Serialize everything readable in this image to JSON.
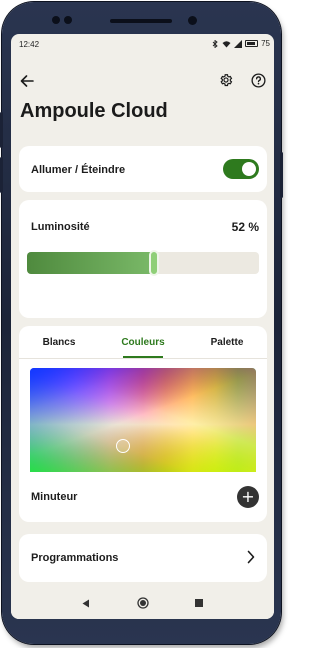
{
  "status_bar": {
    "time": "12:42",
    "battery": "75"
  },
  "app_bar": {
    "back_icon": "arrow-left-icon",
    "settings_icon": "gear-icon",
    "help_icon": "help-circle-icon"
  },
  "page_title": "Ampoule Cloud",
  "power": {
    "label": "Allumer / Éteindre",
    "on": true
  },
  "brightness": {
    "label": "Luminosité",
    "value_text": "52 %",
    "value": 0.52
  },
  "tabs": [
    {
      "label": "Blancs",
      "active": false
    },
    {
      "label": "Couleurs",
      "active": true
    },
    {
      "label": "Palette",
      "active": false
    }
  ],
  "timer": {
    "label": "Minuteur",
    "add_icon": "plus-icon"
  },
  "schedules": {
    "label": "Programmations",
    "chevron_icon": "chevron-right-icon"
  },
  "colors": {
    "accent": "#2e7a1e",
    "background": "#f1efe9",
    "card": "#ffffff"
  }
}
